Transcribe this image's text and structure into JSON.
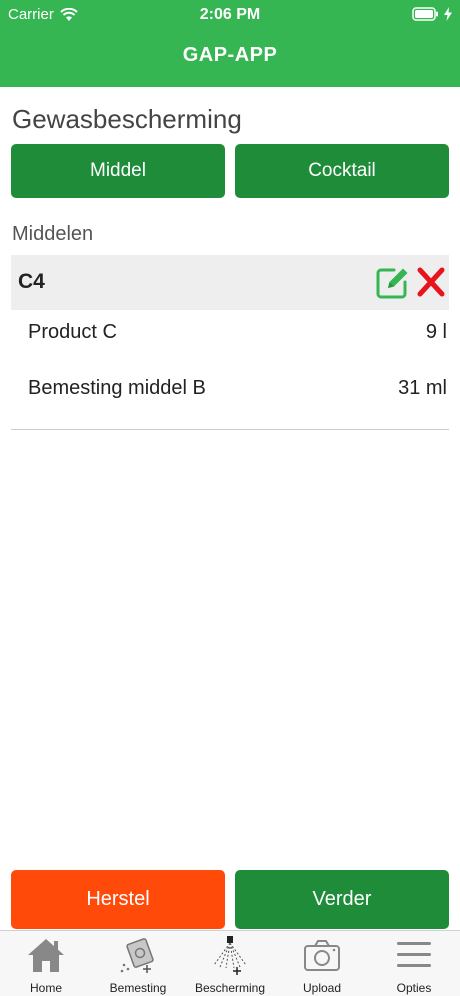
{
  "status_bar": {
    "carrier": "Carrier",
    "time": "2:06 PM"
  },
  "header": {
    "title": "GAP-APP"
  },
  "page": {
    "title": "Gewasbescherming",
    "buttons": {
      "middel": "Middel",
      "cocktail": "Cocktail"
    },
    "list_title": "Middelen"
  },
  "group": {
    "name": "C4",
    "items": [
      {
        "name": "Product C",
        "quantity": "9 l"
      },
      {
        "name": "Bemesting middel B",
        "quantity": "31 ml"
      }
    ]
  },
  "actions": {
    "reset": "Herstel",
    "next": "Verder"
  },
  "tabbar": {
    "tabs": [
      {
        "label": "Home",
        "icon": "home-icon"
      },
      {
        "label": "Bemesting",
        "icon": "fertilizer-icon"
      },
      {
        "label": "Bescherming",
        "icon": "sprayer-icon"
      },
      {
        "label": "Upload",
        "icon": "camera-icon"
      },
      {
        "label": "Opties",
        "icon": "menu-icon"
      }
    ]
  },
  "colors": {
    "header_green": "#35b653",
    "button_green": "#1e8c39",
    "reset_orange": "#ff4a0a",
    "edit_icon_green": "#35b653",
    "delete_icon_red": "#e8141c"
  }
}
